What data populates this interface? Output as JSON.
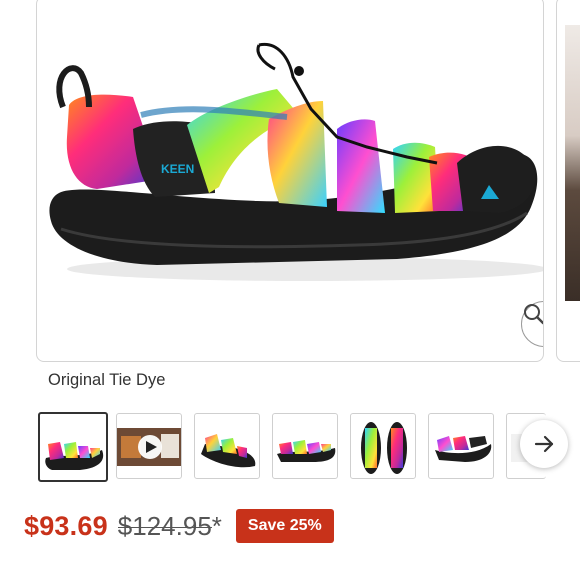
{
  "product": {
    "variant_name": "Original Tie Dye",
    "brand_logo_text": "KEEN"
  },
  "gallery": {
    "thumbnail_count": 7,
    "selected_index": 0,
    "thumbnails": [
      {
        "kind": "sandal-side-view"
      },
      {
        "kind": "video-lifestyle",
        "icon": "play-icon"
      },
      {
        "kind": "sandal-angle-view"
      },
      {
        "kind": "sandal-side-view-pair"
      },
      {
        "kind": "sandal-top-view"
      },
      {
        "kind": "sandal-rear-angle-view"
      },
      {
        "kind": "sandal-partial"
      }
    ],
    "zoom_icon": "magnifier-icon",
    "next_icon": "arrow-right-icon"
  },
  "pricing": {
    "sale_price": "$93.69",
    "original_price": "$124.95*",
    "save_label": "Save 25%"
  },
  "colors": {
    "sale_price": "#c8321a",
    "save_badge_bg": "#c8321a",
    "accent_teal": "#1ba9d4"
  }
}
